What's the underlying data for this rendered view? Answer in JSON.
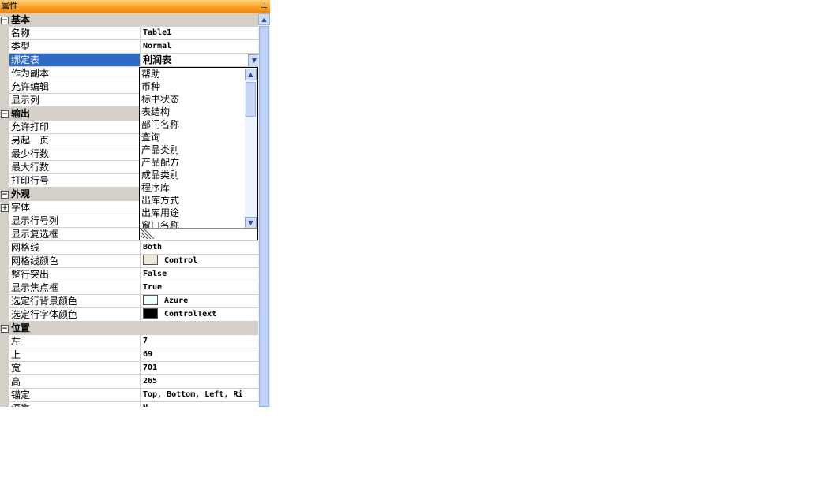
{
  "title": "属性",
  "pin_icon": "pin-icon",
  "categories": {
    "basic": "基本",
    "output": "输出",
    "appearance": "外观",
    "position": "位置"
  },
  "properties": {
    "name": {
      "label": "名称",
      "value": "Table1"
    },
    "type": {
      "label": "类型",
      "value": "Normal"
    },
    "bind_table": {
      "label": "绑定表",
      "value": "利润表"
    },
    "as_copy": {
      "label": "作为副本",
      "value": ""
    },
    "allow_edit": {
      "label": "允许编辑",
      "value": ""
    },
    "show_columns": {
      "label": "显示列",
      "value": ""
    },
    "allow_print": {
      "label": "允许打印",
      "value": ""
    },
    "new_page": {
      "label": "另起一页",
      "value": ""
    },
    "min_rows": {
      "label": "最少行数",
      "value": ""
    },
    "max_rows": {
      "label": "最大行数",
      "value": ""
    },
    "print_row_no": {
      "label": "打印行号",
      "value": ""
    },
    "font": {
      "label": "字体",
      "value": ""
    },
    "show_row_no_col": {
      "label": "显示行号列",
      "value": ""
    },
    "show_checkbox": {
      "label": "显示复选框",
      "value": ""
    },
    "grid_lines": {
      "label": "网格线",
      "value": "Both"
    },
    "grid_line_color": {
      "label": "网格线颜色",
      "value": "Control",
      "swatch": "#ece9d8"
    },
    "full_row_highlight": {
      "label": "整行突出",
      "value": "False"
    },
    "show_focus": {
      "label": "显示焦点框",
      "value": "True"
    },
    "sel_back_color": {
      "label": "选定行背景颜色",
      "value": "Azure",
      "swatch": "#f0ffff"
    },
    "sel_fore_color": {
      "label": "选定行字体颜色",
      "value": "ControlText",
      "swatch": "#000000"
    },
    "left": {
      "label": "左",
      "value": "7"
    },
    "top": {
      "label": "上",
      "value": "69"
    },
    "width": {
      "label": "宽",
      "value": "701"
    },
    "height": {
      "label": "高",
      "value": "265"
    },
    "anchor": {
      "label": "锚定",
      "value": "Top, Bottom, Left, Ri"
    },
    "dock": {
      "label": "停靠",
      "value": "N"
    }
  },
  "dropdown_items": [
    "帮助",
    "币种",
    "标书状态",
    "表结构",
    "部门名称",
    "查询",
    "产品类别",
    "产品配方",
    "成品类别",
    "程序库",
    "出库方式",
    "出库用途",
    "窗口名称"
  ],
  "colors": {
    "selection": "#316ac5",
    "title_bar": "#f79a1e",
    "category_bg": "#d4d0c8"
  }
}
